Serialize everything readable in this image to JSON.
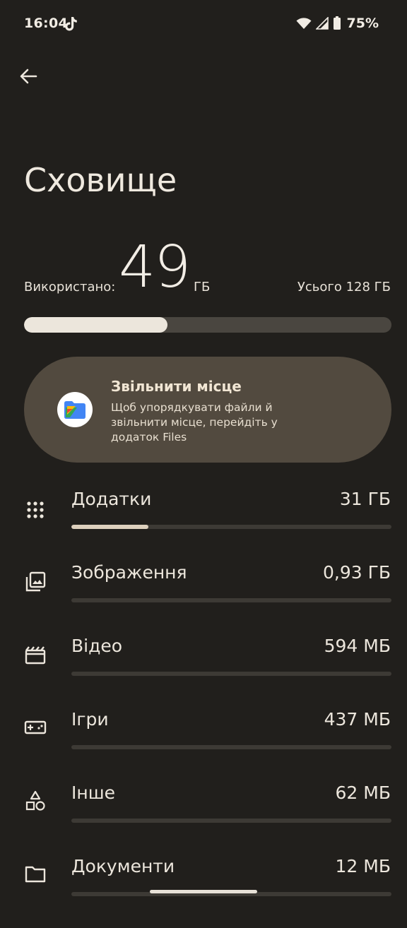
{
  "status_bar": {
    "time": "16:04",
    "battery": "75%"
  },
  "header": {
    "title": "Сховище"
  },
  "usage": {
    "used_label": "Використано:",
    "used_value": "49",
    "used_unit": "ГБ",
    "total_label": "Усього 128 ГБ",
    "used_fraction": 0.39
  },
  "free_up_card": {
    "title": "Звільнити місце",
    "description": "Щоб упорядкувати файли й звільнити місце, перейдіть у додаток Files"
  },
  "categories": [
    {
      "name": "Додатки",
      "size": "31 ГБ",
      "fraction": 0.24,
      "icon": "apps-grid-icon"
    },
    {
      "name": "Зображення",
      "size": "0,93 ГБ",
      "fraction": 0.0,
      "icon": "images-icon"
    },
    {
      "name": "Відео",
      "size": "594 МБ",
      "fraction": 0.0,
      "icon": "video-icon"
    },
    {
      "name": "Ігри",
      "size": "437 МБ",
      "fraction": 0.0,
      "icon": "gamepad-icon"
    },
    {
      "name": "Інше",
      "size": "62 МБ",
      "fraction": 0.0,
      "icon": "shapes-icon"
    },
    {
      "name": "Документи",
      "size": "12 МБ",
      "fraction": 0.0,
      "icon": "folder-icon"
    }
  ],
  "colors": {
    "background": "#211f1c",
    "card": "#524a3f",
    "bar_fill": "#ece6dc",
    "bar_track": "#4a4640"
  }
}
